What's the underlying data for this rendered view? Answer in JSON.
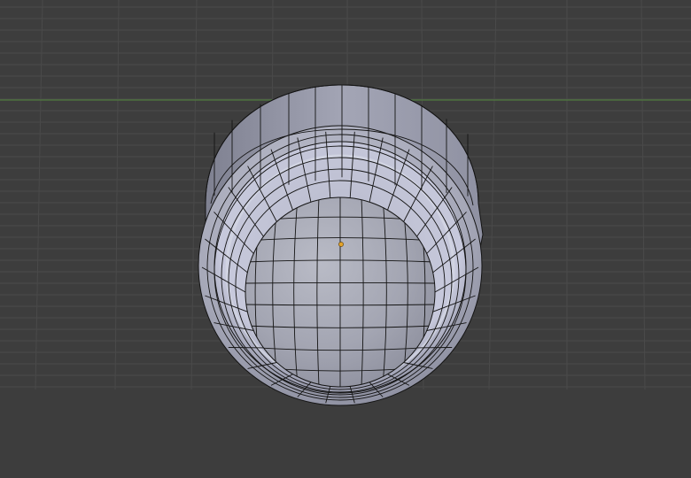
{
  "viewport": {
    "background_color": "#3d3d3d",
    "grid_line_color": "#4a4a4a",
    "horizon_axis_color": "#4f7a3e",
    "mesh": {
      "face_color": "#a9abba",
      "face_shadow_color": "#7d7f8f",
      "face_highlight_color": "#c9cbd9",
      "edge_color": "#141414"
    },
    "origin_marker": {
      "color": "#e3a32b",
      "icon": "object-origin-dot"
    }
  }
}
